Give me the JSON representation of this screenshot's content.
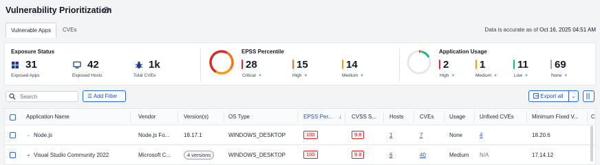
{
  "header": {
    "title": "Vulnerability Prioritization",
    "info_icon": "info-icon"
  },
  "tabs": [
    {
      "label": "Vulnerable Apps",
      "active": true
    },
    {
      "label": "CVEs",
      "active": false
    }
  ],
  "accuracy": {
    "prefix": "Data is accurate as of",
    "timestamp": "Oct 16, 2025 04:51 AM"
  },
  "exposure_status": {
    "title": "Exposure Status",
    "items": [
      {
        "value": "31",
        "label": "Exposed Apps",
        "icon": "apps-grid-icon"
      },
      {
        "value": "42",
        "label": "Exposed Hosts",
        "icon": "monitor-icon"
      },
      {
        "value": "1k",
        "label": "Total CVEs",
        "icon": "bug-icon"
      }
    ]
  },
  "epss_percentile": {
    "title": "EPSS Percentile",
    "items": [
      {
        "value": "28",
        "label": "Critical",
        "color": "#dc2626"
      },
      {
        "value": "15",
        "label": "High",
        "color": "#f97316"
      },
      {
        "value": "14",
        "label": "Medium",
        "color": "#f59e0b"
      }
    ]
  },
  "application_usage": {
    "title": "Application Usage",
    "items": [
      {
        "value": "2",
        "label": "High",
        "color": "#dc2626"
      },
      {
        "value": "1",
        "label": "Medium",
        "color": "#f59e0b"
      },
      {
        "value": "11",
        "label": "Low",
        "color": "#10b981"
      },
      {
        "value": "69",
        "label": "None",
        "color": "#9ca3af"
      }
    ]
  },
  "toolbar": {
    "search_placeholder": "Search",
    "add_filter_label": "Add Filter",
    "export_label": "Export all"
  },
  "table": {
    "columns": [
      "Application Name",
      "Vendor",
      "Version(s)",
      "OS Type",
      "EPSS Per...",
      "CVSS S...",
      "Hosts",
      "CVEs",
      "Usage",
      "Unfixed CVEs",
      "Minimum Fixed V...",
      "C"
    ],
    "rows": [
      {
        "name": "Node.js",
        "vendor": "Node.js Fo...",
        "version": "18.17.1",
        "os": "WINDOWS_DESKTOP",
        "epss": "100",
        "cvss": "9.8",
        "hosts": "1",
        "cves": "7",
        "usage": "None",
        "unfixed": "4",
        "min_fixed": "18.20.6"
      },
      {
        "name": "Visual Studio Community 2022",
        "vendor": "Microsoft C...",
        "version": "4 versions",
        "os": "WINDOWS_DESKTOP",
        "epss": "100",
        "cvss": "9.8",
        "hosts": "6",
        "cves": "40",
        "usage": "Medium",
        "unfixed": "N/A",
        "min_fixed": "17.14.12"
      }
    ]
  }
}
